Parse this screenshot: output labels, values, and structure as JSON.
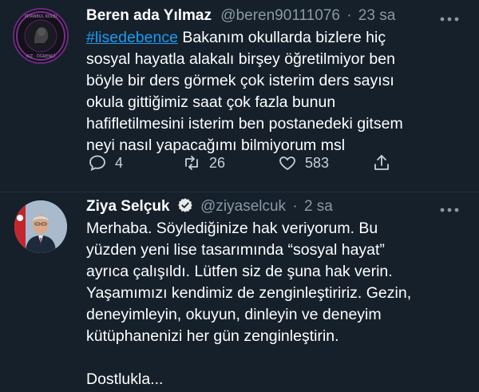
{
  "tweet1": {
    "name": "Beren ada Yılmaz",
    "handle": "@beren90111076",
    "separator": "·",
    "time": "23 sa",
    "hashtag": "#lisedebence",
    "text_after_hashtag": " Bakanım okullarda bizlere hiç",
    "lines": [
      "sosyal hayatla alakalı birşey öğretilmiyor ben",
      "böyle bir ders görmek çok isterim ders sayısı",
      "okula gittiğimiz saat çok fazla bunun",
      "hafifletilmesini isterim ben postanedeki gitsem",
      "neyi nasıl yapacağımı bilmiyorum msl"
    ],
    "avatar_ring_text": "İSTANBUL KOLEJLERI · KIZ ÖĞRENCI · BU",
    "actions": {
      "reply_count": "4",
      "retweet_count": "26",
      "like_count": "583"
    }
  },
  "tweet2": {
    "name": "Ziya Selçuk",
    "handle": "@ziyaselcuk",
    "separator": "·",
    "time": "2 sa",
    "lines": [
      "Merhaba. Söylediğinize hak veriyorum. Bu",
      "yüzden yeni lise tasarımında “sosyal hayat”",
      "ayrıca çalışıldı. Lütfen siz de şuna hak verin.",
      "Yaşamımızı kendimiz de zenginleştiririz. Gezin,",
      "deneyimleyin, okuyun, dinleyin ve deneyim",
      "kütüphanenizi her gün zenginleştirin."
    ],
    "closing": "Dostlukla..."
  },
  "icons": {
    "more": "more-dots-icon",
    "reply": "reply-icon",
    "retweet": "retweet-icon",
    "like": "heart-icon",
    "share": "share-icon",
    "verified": "verified-badge-icon"
  },
  "colors": {
    "background": "#15202b",
    "text": "#ffffff",
    "muted": "#8899a6",
    "link": "#1d9bf0"
  }
}
